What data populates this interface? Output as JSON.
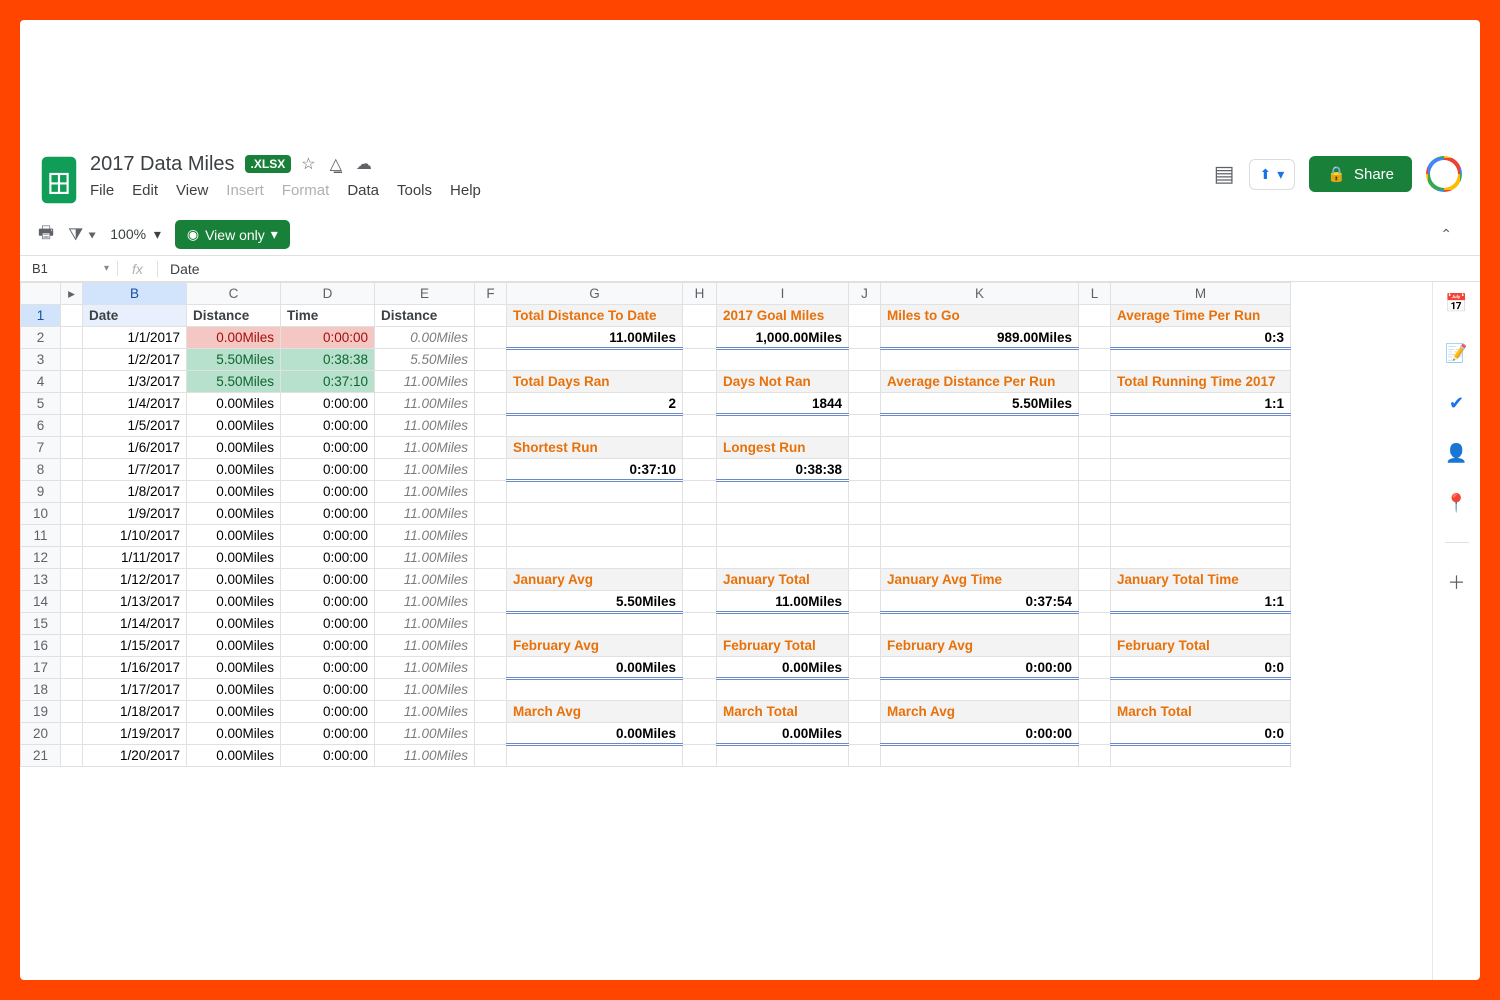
{
  "doc": {
    "title": "2017 Data Miles",
    "badge": ".XLSX",
    "share": "Share",
    "viewonly": "View only",
    "zoom": "100%",
    "cellref": "B1",
    "cellref_arrow": "▾",
    "fx": "fx",
    "fxvalue": "Date",
    "collapse": "⌃"
  },
  "menu": [
    "File",
    "Edit",
    "View",
    "Insert",
    "Format",
    "Data",
    "Tools",
    "Help"
  ],
  "menu_disabled": [
    "Insert",
    "Format"
  ],
  "columns": {
    "arrow": "▸",
    "B": "B",
    "C": "C",
    "D": "D",
    "E": "E",
    "F": "F",
    "G": "G",
    "H": "H",
    "I": "I",
    "J": "J",
    "K": "K",
    "L": "L",
    "M": "M"
  },
  "headers": {
    "B": "Date",
    "C": "Distance",
    "D": "Time",
    "E": "Distance"
  },
  "rows": [
    {
      "n": 2,
      "date": "1/1/2017",
      "dist": "0.00Miles",
      "time": "0:00:00",
      "e": "0.00Miles",
      "hl": "red"
    },
    {
      "n": 3,
      "date": "1/2/2017",
      "dist": "5.50Miles",
      "time": "0:38:38",
      "e": "5.50Miles",
      "hl": "grn"
    },
    {
      "n": 4,
      "date": "1/3/2017",
      "dist": "5.50Miles",
      "time": "0:37:10",
      "e": "11.00Miles",
      "hl": "grn"
    },
    {
      "n": 5,
      "date": "1/4/2017",
      "dist": "0.00Miles",
      "time": "0:00:00",
      "e": "11.00Miles"
    },
    {
      "n": 6,
      "date": "1/5/2017",
      "dist": "0.00Miles",
      "time": "0:00:00",
      "e": "11.00Miles"
    },
    {
      "n": 7,
      "date": "1/6/2017",
      "dist": "0.00Miles",
      "time": "0:00:00",
      "e": "11.00Miles"
    },
    {
      "n": 8,
      "date": "1/7/2017",
      "dist": "0.00Miles",
      "time": "0:00:00",
      "e": "11.00Miles"
    },
    {
      "n": 9,
      "date": "1/8/2017",
      "dist": "0.00Miles",
      "time": "0:00:00",
      "e": "11.00Miles"
    },
    {
      "n": 10,
      "date": "1/9/2017",
      "dist": "0.00Miles",
      "time": "0:00:00",
      "e": "11.00Miles"
    },
    {
      "n": 11,
      "date": "1/10/2017",
      "dist": "0.00Miles",
      "time": "0:00:00",
      "e": "11.00Miles"
    },
    {
      "n": 12,
      "date": "1/11/2017",
      "dist": "0.00Miles",
      "time": "0:00:00",
      "e": "11.00Miles"
    },
    {
      "n": 13,
      "date": "1/12/2017",
      "dist": "0.00Miles",
      "time": "0:00:00",
      "e": "11.00Miles"
    },
    {
      "n": 14,
      "date": "1/13/2017",
      "dist": "0.00Miles",
      "time": "0:00:00",
      "e": "11.00Miles"
    },
    {
      "n": 15,
      "date": "1/14/2017",
      "dist": "0.00Miles",
      "time": "0:00:00",
      "e": "11.00Miles"
    },
    {
      "n": 16,
      "date": "1/15/2017",
      "dist": "0.00Miles",
      "time": "0:00:00",
      "e": "11.00Miles"
    },
    {
      "n": 17,
      "date": "1/16/2017",
      "dist": "0.00Miles",
      "time": "0:00:00",
      "e": "11.00Miles"
    },
    {
      "n": 18,
      "date": "1/17/2017",
      "dist": "0.00Miles",
      "time": "0:00:00",
      "e": "11.00Miles"
    },
    {
      "n": 19,
      "date": "1/18/2017",
      "dist": "0.00Miles",
      "time": "0:00:00",
      "e": "11.00Miles"
    },
    {
      "n": 20,
      "date": "1/19/2017",
      "dist": "0.00Miles",
      "time": "0:00:00",
      "e": "11.00Miles"
    },
    {
      "n": 21,
      "date": "1/20/2017",
      "dist": "0.00Miles",
      "time": "0:00:00",
      "e": "11.00Miles"
    }
  ],
  "stats": {
    "1": {
      "G": {
        "l": "Total Distance To Date",
        "v": "11.00Miles"
      },
      "I": {
        "l": "2017 Goal Miles",
        "v": "1,000.00Miles"
      },
      "K": {
        "l": "Miles to Go",
        "v": "989.00Miles"
      },
      "M": {
        "l": "Average Time Per Run",
        "v": "0:3"
      }
    },
    "4": {
      "G": {
        "l": "Total Days Ran",
        "v": "2"
      },
      "I": {
        "l": "Days Not Ran",
        "v": "1844"
      },
      "K": {
        "l": "Average Distance Per Run",
        "v": "5.50Miles"
      },
      "M": {
        "l": "Total Running Time 2017",
        "v": "1:1"
      }
    },
    "7": {
      "G": {
        "l": "Shortest Run",
        "v": "0:37:10"
      },
      "I": {
        "l": "Longest Run",
        "v": "0:38:38"
      }
    },
    "13": {
      "G": {
        "l": "January Avg",
        "v": "5.50Miles"
      },
      "I": {
        "l": "January Total",
        "v": "11.00Miles"
      },
      "K": {
        "l": "January Avg Time",
        "v": "0:37:54"
      },
      "M": {
        "l": "January Total Time",
        "v": "1:1"
      }
    },
    "16": {
      "G": {
        "l": "February Avg",
        "v": "0.00Miles"
      },
      "I": {
        "l": "February Total",
        "v": "0.00Miles"
      },
      "K": {
        "l": "February Avg",
        "v": "0:00:00"
      },
      "M": {
        "l": "February Total",
        "v": "0:0"
      }
    },
    "19": {
      "G": {
        "l": "March Avg",
        "v": "0.00Miles"
      },
      "I": {
        "l": "March Total",
        "v": "0.00Miles"
      },
      "K": {
        "l": "March Avg",
        "v": "0:00:00"
      },
      "M": {
        "l": "March Total",
        "v": "0:0"
      }
    }
  },
  "sidepanel": [
    "calendar",
    "keep",
    "tasks",
    "contacts",
    "maps",
    "add"
  ]
}
